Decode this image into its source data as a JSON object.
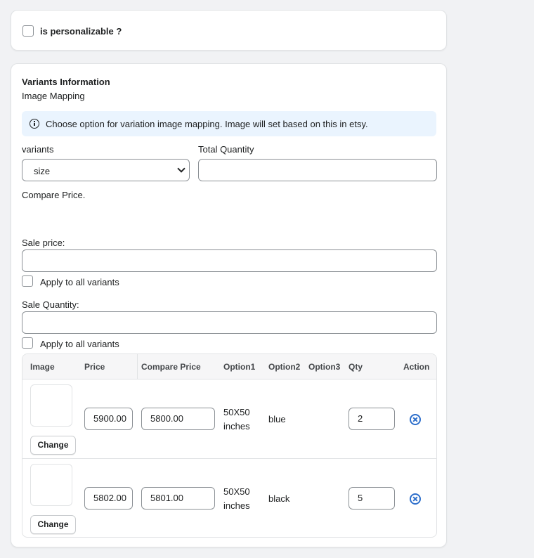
{
  "personalize": {
    "label": "is personalizable ?"
  },
  "variants_info": {
    "title": "Variants Information",
    "subtitle": "Image Mapping",
    "banner_text": "Choose option for variation image mapping. Image will set based on this in etsy.",
    "variants_label": "variants",
    "variants_selected": "size",
    "total_quantity_label": "Total Quantity",
    "compare_price_label": "Compare Price.",
    "sale_price_label": "Sale price:",
    "apply_all_label_1": "Apply to all variants",
    "sale_quantity_label": "Sale Quantity:",
    "apply_all_label_2": "Apply to all variants"
  },
  "table": {
    "headers": {
      "image": "Image",
      "price": "Price",
      "compare_price": "Compare Price",
      "option1": "Option1",
      "option2": "Option2",
      "option3": "Option3",
      "qty": "Qty",
      "action": "Action"
    },
    "rows": [
      {
        "price": "5900.00",
        "compare_price": "5800.00",
        "option1_line1": "50X50",
        "option1_line2": "inches",
        "option2": "blue",
        "option3": "",
        "qty": "2",
        "change_label": "Change"
      },
      {
        "price": "5802.00",
        "compare_price": "5801.00",
        "option1_line1": "50X50",
        "option1_line2": "inches",
        "option2": "black",
        "option3": "",
        "qty": "5",
        "change_label": "Change"
      }
    ]
  },
  "colors": {
    "accent": "#2c6ecb",
    "banner_bg": "#eaf4fe",
    "page_bg": "#f1f2f4"
  }
}
